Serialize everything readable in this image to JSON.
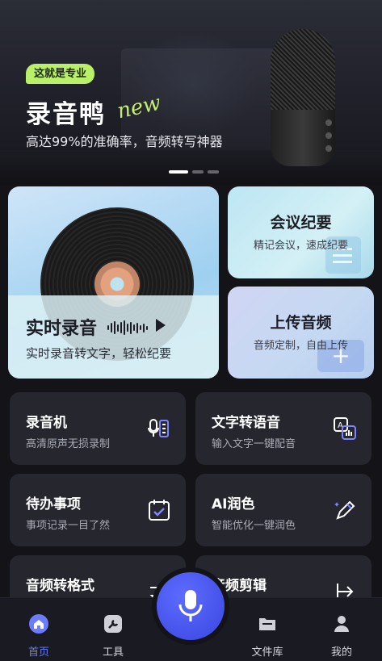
{
  "banner": {
    "tag": "这就是专业",
    "brand": "录音鸭",
    "new_word": "new",
    "subtitle": "高达99%的准确率，音频转写神器",
    "slide_count": 3,
    "active_slide": 1
  },
  "features": {
    "live": {
      "title": "实时录音",
      "subtitle": "实时录音转文字，轻松纪要"
    },
    "meeting": {
      "title": "会议纪要",
      "subtitle": "精记会议，速成纪要"
    },
    "upload": {
      "title": "上传音频",
      "subtitle": "音频定制，自由上传"
    }
  },
  "tools": [
    {
      "title": "录音机",
      "subtitle": "高清原声无损录制",
      "icon": "recorder-icon"
    },
    {
      "title": "文字转语音",
      "subtitle": "输入文字一键配音",
      "icon": "text-to-speech-icon"
    },
    {
      "title": "待办事项",
      "subtitle": "事项记录一目了然",
      "icon": "calendar-check-icon"
    },
    {
      "title": "AI润色",
      "subtitle": "智能优化一键润色",
      "icon": "magic-pen-icon"
    },
    {
      "title": "音频转格式",
      "subtitle": "",
      "icon": "convert-icon"
    },
    {
      "title": "音频剪辑",
      "subtitle": "",
      "icon": "cut-icon"
    }
  ],
  "nav": {
    "items": [
      {
        "label": "首页",
        "icon": "home-icon",
        "active": true
      },
      {
        "label": "工具",
        "icon": "wrench-icon",
        "active": false
      },
      {
        "label": "文件库",
        "icon": "folder-icon",
        "active": false
      },
      {
        "label": "我的",
        "icon": "user-icon",
        "active": false
      }
    ],
    "record_button_icon": "microphone-icon"
  },
  "colors": {
    "accent": "#4a56f0",
    "tag_green": "#b9f06a",
    "card_bg": "#25262e",
    "background": "#131318",
    "nav_active": "#6b7cff"
  }
}
